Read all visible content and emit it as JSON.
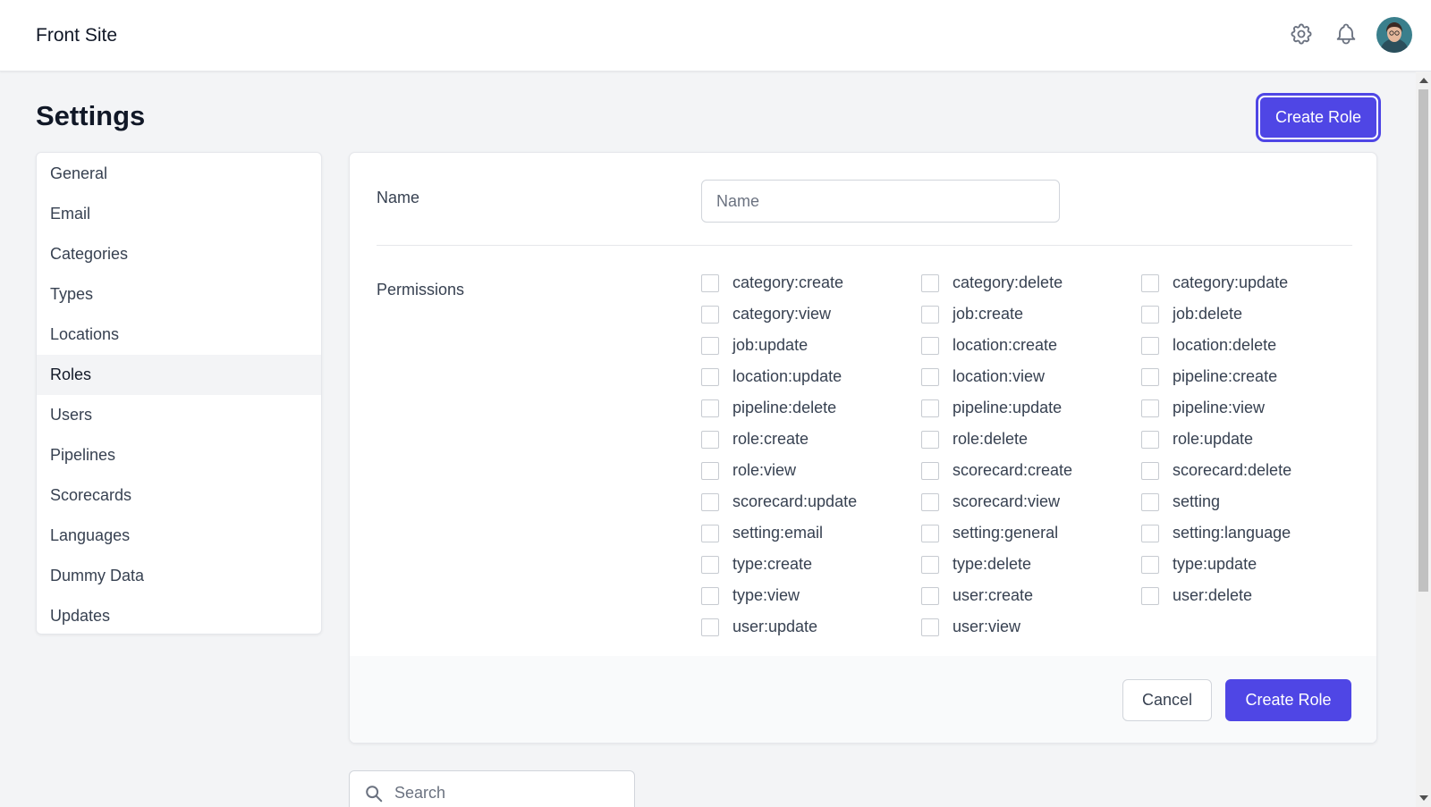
{
  "header": {
    "brand": "Front Site",
    "icons": [
      "gear-icon",
      "bell-icon",
      "avatar"
    ]
  },
  "page": {
    "title": "Settings",
    "create_role_label": "Create Role"
  },
  "sidebar": {
    "active": "Roles",
    "items": [
      {
        "label": "General"
      },
      {
        "label": "Email"
      },
      {
        "label": "Categories"
      },
      {
        "label": "Types"
      },
      {
        "label": "Locations"
      },
      {
        "label": "Roles"
      },
      {
        "label": "Users"
      },
      {
        "label": "Pipelines"
      },
      {
        "label": "Scorecards"
      },
      {
        "label": "Languages"
      },
      {
        "label": "Dummy Data"
      },
      {
        "label": "Updates"
      }
    ]
  },
  "form": {
    "name_label": "Name",
    "name_value": "",
    "name_placeholder": "Name",
    "permissions_label": "Permissions",
    "permissions": [
      "category:create",
      "category:delete",
      "category:update",
      "category:view",
      "job:create",
      "job:delete",
      "job:update",
      "location:create",
      "location:delete",
      "location:update",
      "location:view",
      "pipeline:create",
      "pipeline:delete",
      "pipeline:update",
      "pipeline:view",
      "role:create",
      "role:delete",
      "role:update",
      "role:view",
      "scorecard:create",
      "scorecard:delete",
      "scorecard:update",
      "scorecard:view",
      "setting",
      "setting:email",
      "setting:general",
      "setting:language",
      "type:create",
      "type:delete",
      "type:update",
      "type:view",
      "user:create",
      "user:delete",
      "user:update",
      "user:view"
    ],
    "cancel_label": "Cancel",
    "submit_label": "Create Role"
  },
  "search": {
    "placeholder": "Search",
    "value": ""
  },
  "colors": {
    "accent": "#4f46e5",
    "background": "#f3f4f6",
    "surface": "#ffffff"
  }
}
